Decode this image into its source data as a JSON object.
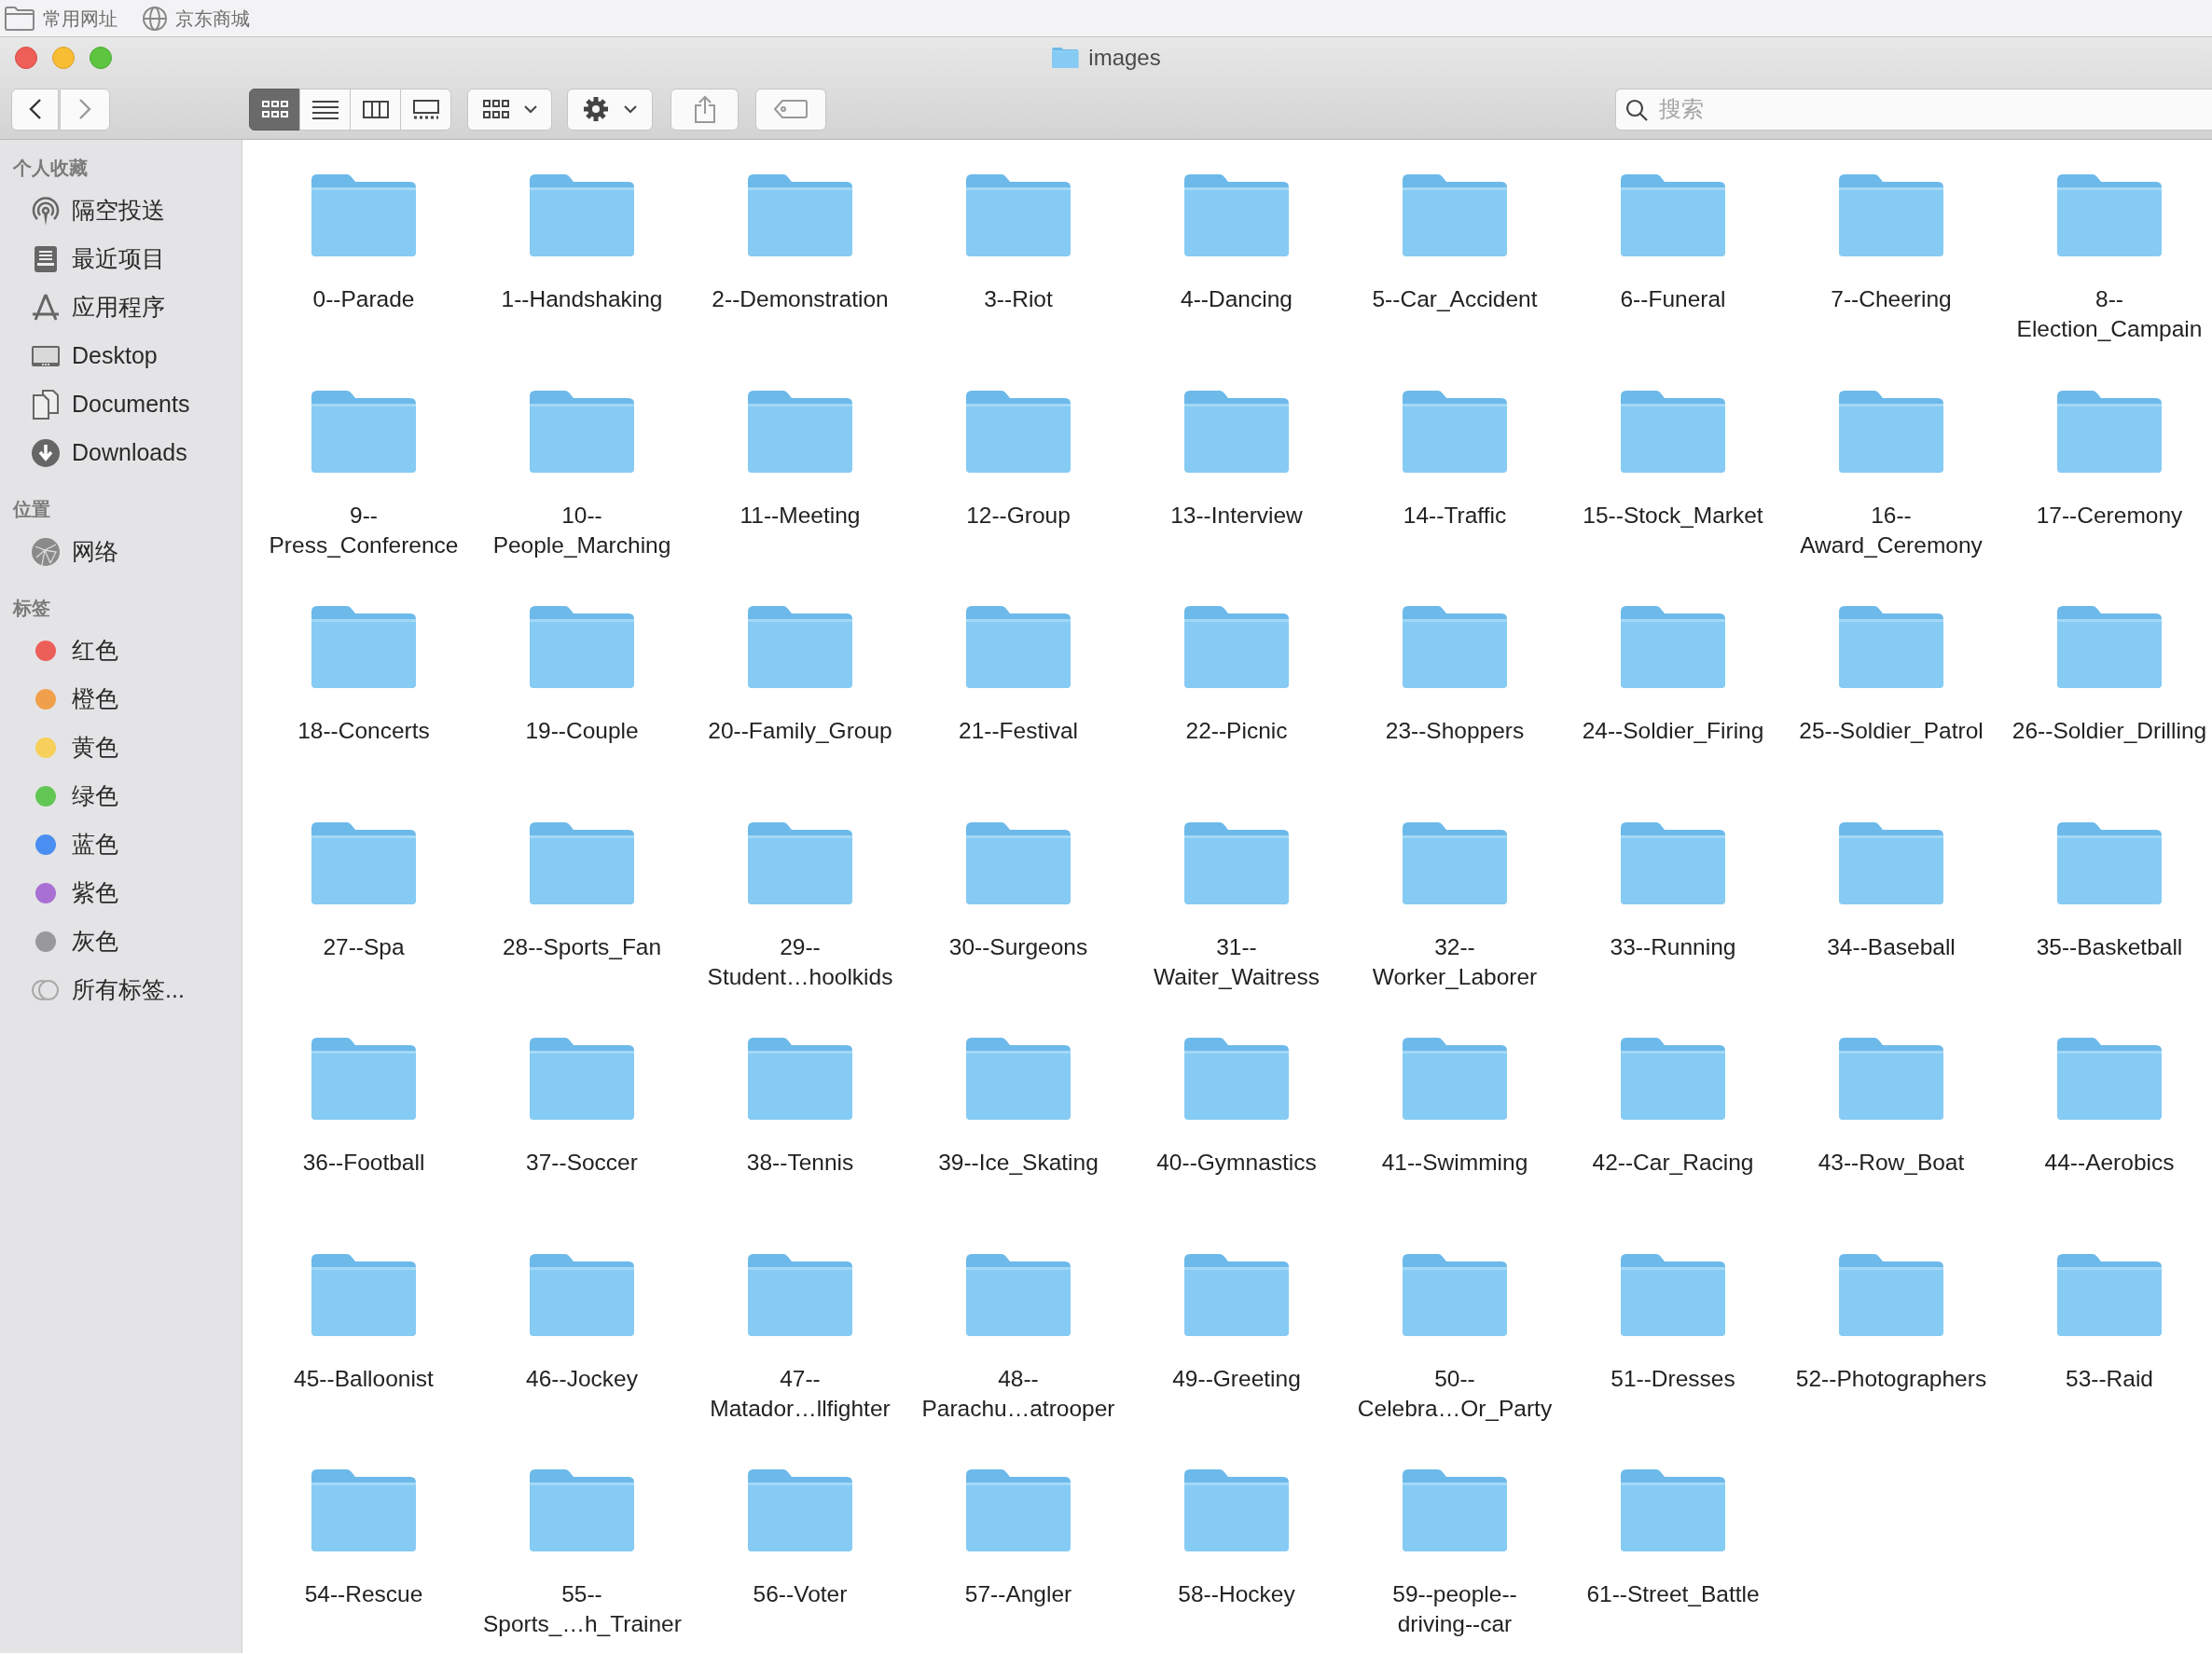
{
  "bookmarks": [
    {
      "kind": "folder",
      "label": "常用网址"
    },
    {
      "kind": "globe",
      "label": "京东商城"
    }
  ],
  "window": {
    "title": "images"
  },
  "toolbar": {
    "view_modes": [
      {
        "kind": "icons",
        "selected": true
      },
      {
        "kind": "list",
        "selected": false
      },
      {
        "kind": "columns",
        "selected": false
      },
      {
        "kind": "gallery",
        "selected": false
      }
    ],
    "search": {
      "placeholder": "搜索"
    }
  },
  "sidebar": [
    {
      "heading": "个人收藏",
      "items": [
        {
          "kind": "airdrop",
          "label": "隔空投送"
        },
        {
          "kind": "recents",
          "label": "最近项目"
        },
        {
          "kind": "apps",
          "label": "应用程序"
        },
        {
          "kind": "desktop",
          "label": "Desktop"
        },
        {
          "kind": "documents",
          "label": "Documents"
        },
        {
          "kind": "downloads",
          "label": "Downloads"
        }
      ]
    },
    {
      "heading": "位置",
      "items": [
        {
          "kind": "network",
          "label": "网络"
        }
      ]
    },
    {
      "heading": "标签",
      "items": [
        {
          "kind": "tag",
          "label": "红色",
          "color": "#ec5f59"
        },
        {
          "kind": "tag",
          "label": "橙色",
          "color": "#f0a04b"
        },
        {
          "kind": "tag",
          "label": "黄色",
          "color": "#f6d05a"
        },
        {
          "kind": "tag",
          "label": "绿色",
          "color": "#62c655"
        },
        {
          "kind": "tag",
          "label": "蓝色",
          "color": "#4a8ef1"
        },
        {
          "kind": "tag",
          "label": "紫色",
          "color": "#a970d4"
        },
        {
          "kind": "tag",
          "label": "灰色",
          "color": "#98989d"
        },
        {
          "kind": "alltags",
          "label": "所有标签..."
        }
      ]
    }
  ],
  "folders": [
    "0--Parade",
    "1--Handshaking",
    "2--Demonstration",
    "3--Riot",
    "4--Dancing",
    "5--Car_Accident",
    "6--Funeral",
    "7--Cheering",
    "8--Election_Campain",
    "9--Press_Conference",
    "10--People_Marching",
    "11--Meeting",
    "12--Group",
    "13--Interview",
    "14--Traffic",
    "15--Stock_Market",
    "16--Award_Ceremony",
    "17--Ceremony",
    "18--Concerts",
    "19--Couple",
    "20--Family_Group",
    "21--Festival",
    "22--Picnic",
    "23--Shoppers",
    "24--Soldier_Firing",
    "25--Soldier_Patrol",
    "26--Soldier_Drilling",
    "27--Spa",
    "28--Sports_Fan",
    "29--Student…hoolkids",
    "30--Surgeons",
    "31--Waiter_Waitress",
    "32--Worker_Laborer",
    "33--Running",
    "34--Baseball",
    "35--Basketball",
    "36--Football",
    "37--Soccer",
    "38--Tennis",
    "39--Ice_Skating",
    "40--Gymnastics",
    "41--Swimming",
    "42--Car_Racing",
    "43--Row_Boat",
    "44--Aerobics",
    "45--Balloonist",
    "46--Jockey",
    "47--Matador…llfighter",
    "48--Parachu…atrooper",
    "49--Greeting",
    "50--Celebra…Or_Party",
    "51--Dresses",
    "52--Photographers",
    "53--Raid",
    "54--Rescue",
    "55--Sports_…h_Trainer",
    "56--Voter",
    "57--Angler",
    "58--Hockey",
    "59--people--driving--car",
    "61--Street_Battle"
  ]
}
